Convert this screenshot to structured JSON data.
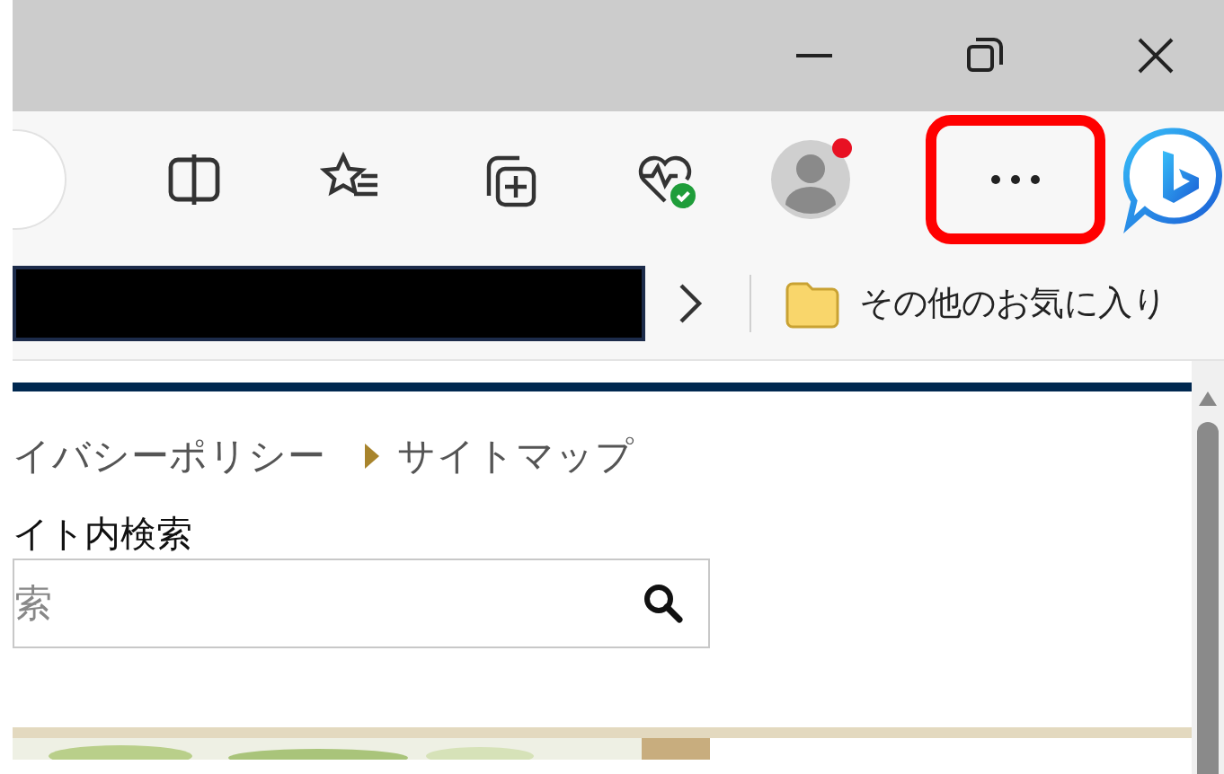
{
  "toolbar": {
    "profile": {
      "notification": true
    }
  },
  "favorites_bar": {
    "other_favorites": "その他のお気に入り"
  },
  "page": {
    "links": [
      {
        "text": "イバシーポリシー",
        "bullet": false
      },
      {
        "text": "サイトマップ",
        "bullet": true
      }
    ],
    "search": {
      "label": "イト内検索",
      "placeholder": "索"
    }
  }
}
